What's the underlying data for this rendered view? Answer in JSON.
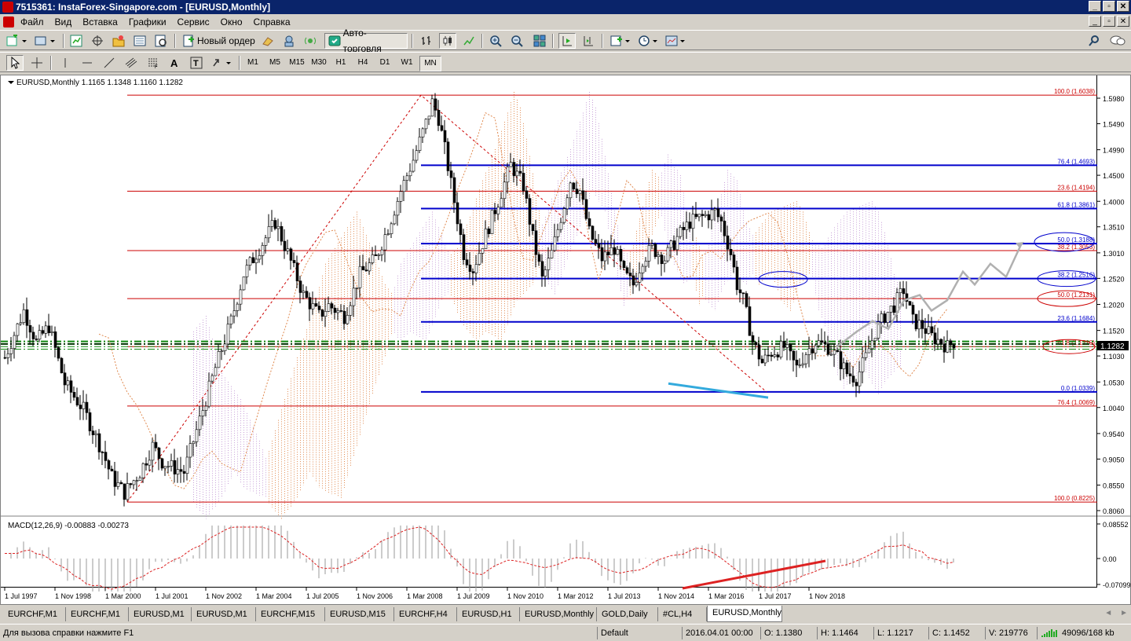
{
  "window": {
    "title": "7515361: InstaForex-Singapore.com - [EURUSD,Monthly]"
  },
  "menu": [
    "Файл",
    "Вид",
    "Вставка",
    "Графики",
    "Сервис",
    "Окно",
    "Справка"
  ],
  "toolbar": {
    "new_order": "Новый ордер",
    "autotrading": "Авто-торговля"
  },
  "timeframes": [
    "M1",
    "M5",
    "M15",
    "M30",
    "H1",
    "H4",
    "D1",
    "W1",
    "MN"
  ],
  "active_timeframe": "MN",
  "chart": {
    "header": "EURUSD,Monthly  1.1165 1.1348 1.1160 1.1282",
    "price_tag": "1.1282",
    "colors": {
      "fibo_red": "#cc0000",
      "fibo_blue": "#0000cc",
      "bull": "#000000",
      "ichimoku_a": "#e08a50",
      "ichimoku_b": "#c8a0d8",
      "projection": "#b0b0b0",
      "wedge": "#33aadd",
      "macd_trend": "#dd2222"
    },
    "price_axis": [
      "1.5980",
      "1.5490",
      "1.4990",
      "1.4500",
      "1.4000",
      "1.3510",
      "1.3010",
      "1.2520",
      "1.2020",
      "1.1520",
      "1.1030",
      "1.0530",
      "1.0040",
      "0.9540",
      "0.9050",
      "0.8550",
      "0.8060"
    ],
    "fib_labels": {
      "blue": [
        "76.4 (1.4693)",
        "61.8 (1.3861)",
        "50.0 (1.3188)",
        "38.2 (1.2516)",
        "23.6 (1.1684)",
        "0.0 (1.0339)"
      ],
      "red": [
        "100.0 (1.6038)",
        "23.6 (1.4194)",
        "38.2 (1.3053)",
        "50.0 (1.2131)",
        "61.8 (1.1210)",
        "76.4 (1.0069)",
        "100.0 (0.8225)"
      ]
    },
    "macd": {
      "label": "MACD(12,26,9) -0.00883 -0.00273",
      "axis": [
        "0.08552",
        "0.00",
        "-0.07099"
      ]
    },
    "time_axis": [
      "1 Jul 1997",
      "1 Nov 1998",
      "1 Mar 2000",
      "1 Jul 2001",
      "1 Nov 2002",
      "1 Mar 2004",
      "1 Jul 2005",
      "1 Nov 2006",
      "1 Mar 2008",
      "1 Jul 2009",
      "1 Nov 2010",
      "1 Mar 2012",
      "1 Jul 2013",
      "1 Nov 2014",
      "1 Mar 2016",
      "1 Jul 2017",
      "1 Nov 2018"
    ]
  },
  "tabs": [
    "EURCHF,M1",
    "EURCHF,M1",
    "EURUSD,M1",
    "EURUSD,M1",
    "EURCHF,M15",
    "EURUSD,M15",
    "EURCHF,H4",
    "EURUSD,H1",
    "EURUSD,Monthly",
    "GOLD,Daily",
    "#CL,H4",
    "EURUSD,Monthly"
  ],
  "active_tab": 11,
  "status": {
    "help": "Для вызова справки нажмите F1",
    "profile": "Default",
    "datetime": "2016.04.01 00:00",
    "open": "O: 1.1380",
    "high": "H: 1.1464",
    "low": "L: 1.1217",
    "close": "C: 1.1452",
    "volume": "V: 219776",
    "traffic": "49096/168 kb"
  }
}
